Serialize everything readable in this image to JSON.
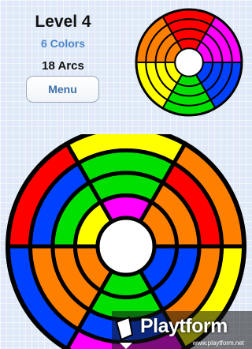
{
  "header": {
    "level": "Level 4",
    "colors": "6 Colors",
    "arcs": "18 Arcs",
    "menu_label": "Menu"
  },
  "palette": {
    "red": "#ff0000",
    "orange": "#ff8000",
    "yellow": "#ffff00",
    "green": "#00e000",
    "blue": "#0040ff",
    "magenta": "#ff00ff",
    "outline": "#000000",
    "center": "#ffffff"
  },
  "target_wheel": {
    "sectors": 6,
    "rings": [
      [
        "red",
        "magenta",
        "blue",
        "green",
        "yellow",
        "orange"
      ],
      [
        "red",
        "magenta",
        "blue",
        "green",
        "yellow",
        "orange"
      ],
      [
        "red",
        "magenta",
        "blue",
        "green",
        "yellow",
        "orange"
      ],
      [
        "red",
        "magenta",
        "blue",
        "green",
        "yellow",
        "orange"
      ]
    ]
  },
  "board_wheel": {
    "sectors": 6,
    "rings": [
      [
        "yellow",
        "orange",
        "yellow",
        "magenta",
        "blue",
        "red"
      ],
      [
        "green",
        "red",
        "orange",
        "blue",
        "orange",
        "blue"
      ],
      [
        "green",
        "orange",
        "blue",
        "green",
        "orange",
        "green"
      ],
      [
        "magenta",
        "orange",
        "blue",
        "green",
        "orange",
        "yellow"
      ]
    ]
  },
  "watermark": {
    "logo": "Playtform",
    "url": "www.playtform.net"
  }
}
